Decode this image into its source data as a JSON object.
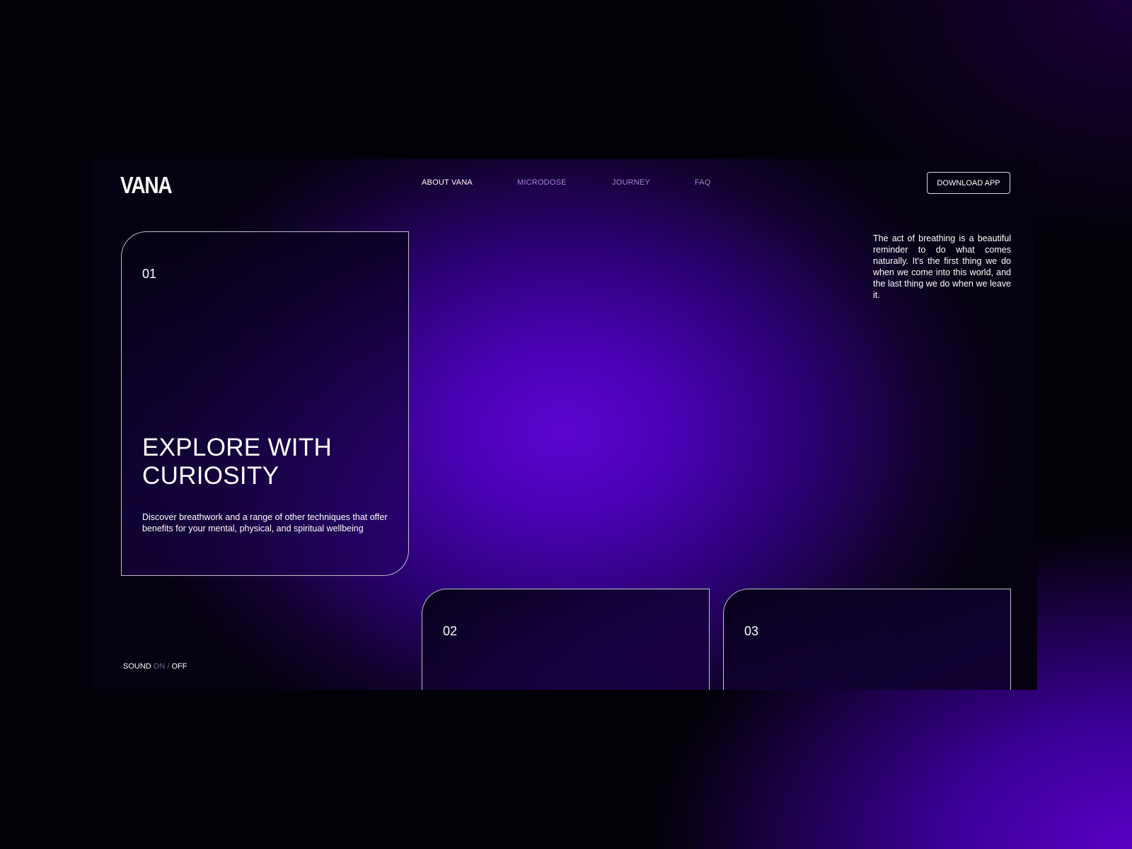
{
  "brand": {
    "logo": "VANA"
  },
  "nav": {
    "items": [
      {
        "label": "ABOUT VANA",
        "active": true
      },
      {
        "label": "MICRODOSE",
        "active": false
      },
      {
        "label": "JOURNEY",
        "active": false
      },
      {
        "label": "FAQ",
        "active": false
      }
    ],
    "cta_label": "DOWNLOAD APP"
  },
  "intro": {
    "text": "The act of breathing is a beautiful reminder to do what comes naturally. It's the first thing we do when we come into this world, and the last thing we do when we leave it."
  },
  "cards": [
    {
      "number": "01",
      "title": "EXPLORE WITH CURIOSITY",
      "description": "Discover breathwork and a range of other techniques that offer benefits for your mental, physical, and spiritual wellbeing"
    },
    {
      "number": "02"
    },
    {
      "number": "03"
    }
  ],
  "sound": {
    "label": "SOUND",
    "on": "ON",
    "separator": "/",
    "off": "OFF",
    "active": "off"
  },
  "colors": {
    "accent_purple": "#5b05d0",
    "deep_purple": "#2c0175",
    "background": "#030108",
    "text": "#ffffff"
  }
}
